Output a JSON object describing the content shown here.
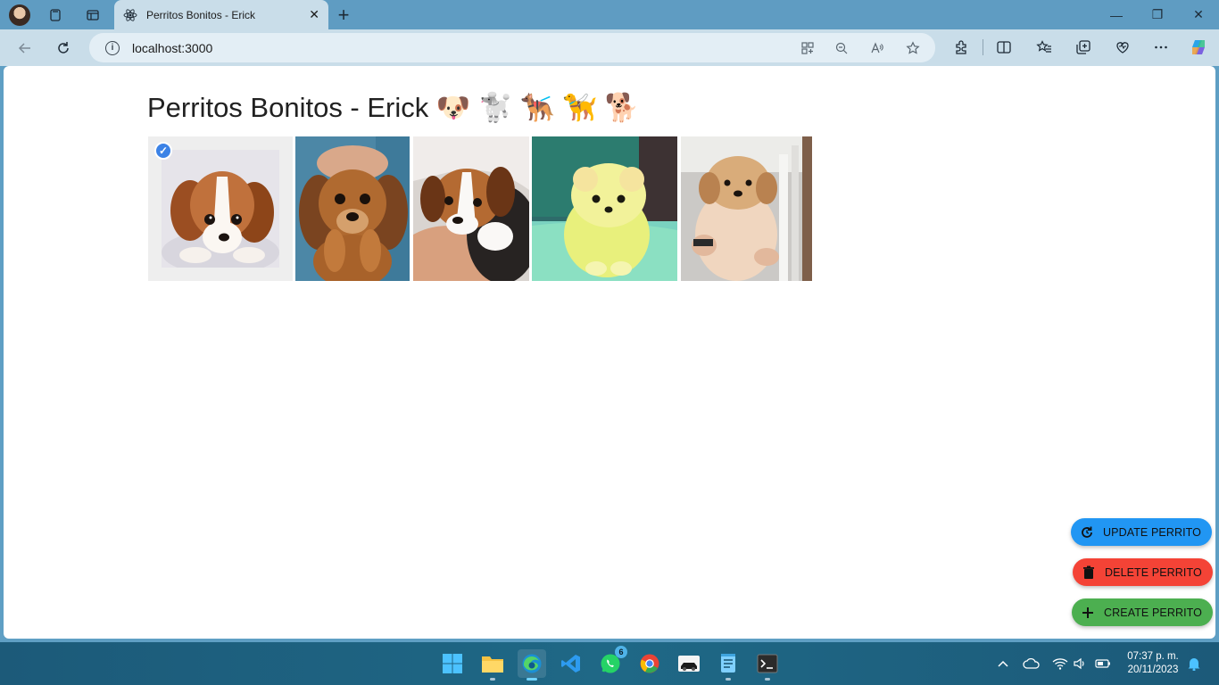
{
  "browser": {
    "tab_title": "Perritos Bonitos - Erick",
    "tab_close": "✕",
    "new_tab": "+",
    "address": "localhost:3000",
    "window_controls": {
      "minimize": "—",
      "restore": "❐",
      "close": "✕"
    }
  },
  "page": {
    "title": "Perritos Bonitos - Erick 🐶 🐩 🐕‍🦺 🦮 🐕",
    "photos": [
      {
        "alt": "cavalier-puppy",
        "selected": true
      },
      {
        "alt": "brown-puppy",
        "selected": false
      },
      {
        "alt": "beagle-puppy",
        "selected": false
      },
      {
        "alt": "pomeranian-puppy",
        "selected": false
      },
      {
        "alt": "golden-puppy",
        "selected": false
      }
    ],
    "buttons": {
      "update": "UPDATE PERRITO",
      "delete": "DELETE PERRITO",
      "create": "CREATE PERRITO"
    },
    "colors": {
      "update": "#2196f3",
      "delete": "#f44336",
      "create": "#4caf50",
      "selected_check": "#3b82e6"
    }
  },
  "taskbar": {
    "whatsapp_badge": "6",
    "time": "07:37 p. m.",
    "date": "20/11/2023"
  }
}
